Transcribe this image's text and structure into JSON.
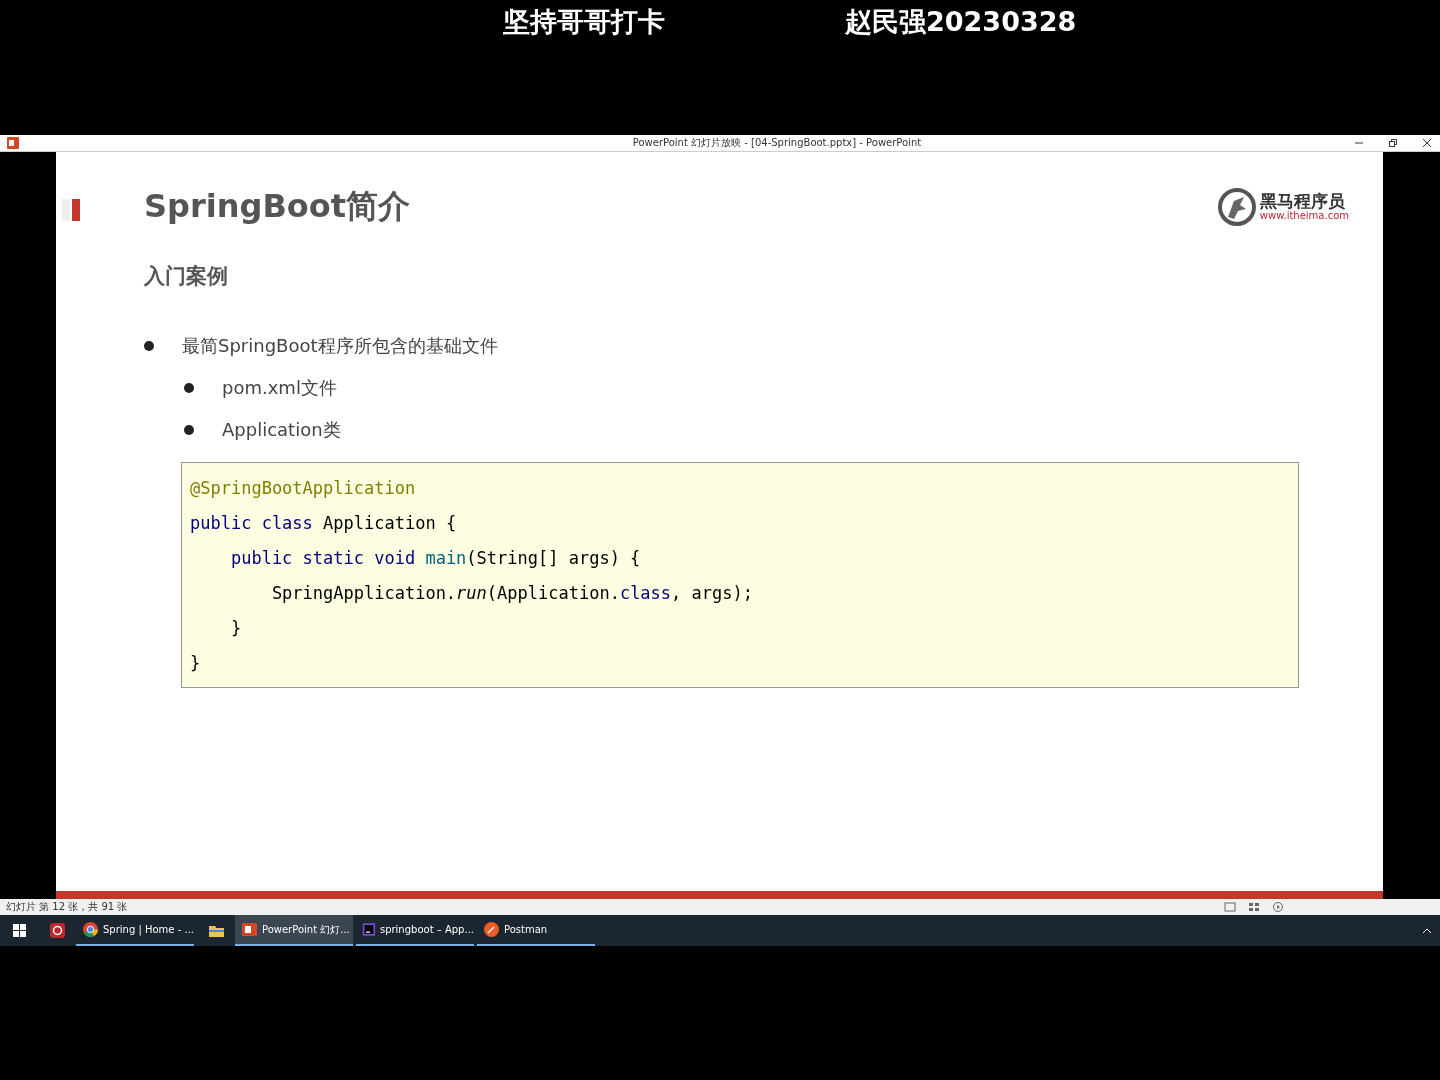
{
  "captions": [
    "坚持哥哥打卡",
    "赵民强20230328"
  ],
  "window": {
    "title": "PowerPoint 幻灯片放映 - [04-SpringBoot.pptx] - PowerPoint"
  },
  "slide": {
    "title": "SpringBoot简介",
    "logo": {
      "name": "黑马程序员",
      "url": "www.itheima.com"
    },
    "subtitle": "入门案例",
    "bullets": [
      {
        "text": "最简SpringBoot程序所包含的基础文件",
        "children": [
          {
            "text": "pom.xml文件"
          },
          {
            "text": "Application类"
          }
        ]
      }
    ],
    "code": [
      [
        {
          "kind": "annotation",
          "text": "@SpringBootApplication"
        }
      ],
      [
        {
          "kind": "keyword",
          "text": "public class "
        },
        {
          "kind": "plain",
          "text": "Application {"
        }
      ],
      [
        {
          "kind": "keyword",
          "text": "    public static void "
        },
        {
          "kind": "decl",
          "text": "main"
        },
        {
          "kind": "plain",
          "text": "(String[] args) {"
        }
      ],
      [
        {
          "kind": "plain",
          "text": "        SpringApplication."
        },
        {
          "kind": "method",
          "text": "run"
        },
        {
          "kind": "plain",
          "text": "(Application."
        },
        {
          "kind": "keyword",
          "text": "class"
        },
        {
          "kind": "plain",
          "text": ", args);"
        }
      ],
      [
        {
          "kind": "plain",
          "text": "    }"
        }
      ],
      [
        {
          "kind": "plain",
          "text": "}"
        }
      ]
    ]
  },
  "status_bar": {
    "text": "幻灯片 第 12 张，共 91 张"
  },
  "taskbar": {
    "items": [
      {
        "kind": "start",
        "selected": false
      },
      {
        "kind": "app",
        "selected": false
      },
      {
        "kind": "chrome",
        "label": "Spring | Home - ...",
        "selected": false
      },
      {
        "kind": "folder",
        "selected": false
      },
      {
        "kind": "powerpoint",
        "label": "PowerPoint 幻灯...",
        "selected": true
      },
      {
        "kind": "intellij",
        "label": "springboot – App...",
        "selected": false
      },
      {
        "kind": "postman",
        "label": "Postman",
        "selected": false
      }
    ]
  }
}
